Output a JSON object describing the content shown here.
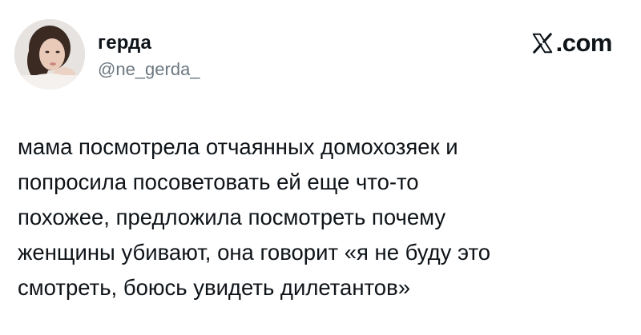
{
  "author": {
    "display_name": "герда",
    "handle": "@ne_gerda_",
    "avatar": "profile-photo"
  },
  "brand": {
    "label": ".com",
    "icon": "x-logo-icon"
  },
  "tweet": {
    "text": "мама посмотрела отчаянных домохозяек и\nпопросила посоветовать ей еще что-то\nпохожее, предложила посмотреть почему\nженщины убивают, она говорит «я не буду это\nсмотреть, боюсь увидеть дилетантов»"
  }
}
